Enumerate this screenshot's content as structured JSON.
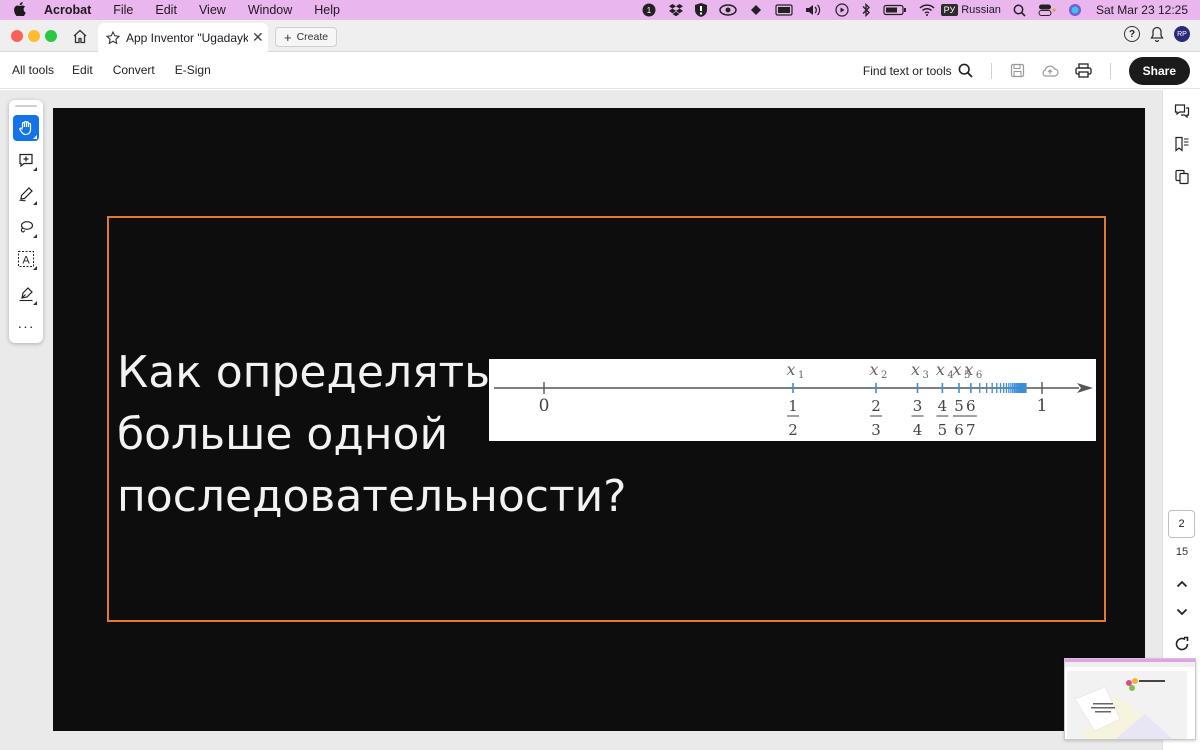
{
  "menubar": {
    "app_name": "Acrobat",
    "menus": [
      "File",
      "Edit",
      "View",
      "Window",
      "Help"
    ],
    "badge_count": "1",
    "input_badge": "РУ",
    "input_language": "Russian",
    "clock": "Sat Mar 23  12:25"
  },
  "tabbar": {
    "tab_title": "App Inventor \"Ugadayk...",
    "create_label": "Create",
    "avatar_initials": "RP"
  },
  "toolbar": {
    "all_tools": "All tools",
    "edit": "Edit",
    "convert": "Convert",
    "esign": "E-Sign",
    "find": "Find text or tools",
    "share": "Share"
  },
  "slide": {
    "heading": "Как определять\nбольше одной\nпоследовательности?",
    "frame_color": "#e07a2e",
    "figure": {
      "left_end_label": "0",
      "right_end_label": "1",
      "points": [
        {
          "var": "x",
          "sub": "1",
          "num": "1",
          "den": "2",
          "value": 0.5
        },
        {
          "var": "x",
          "sub": "2",
          "num": "2",
          "den": "3",
          "value": 0.6667
        },
        {
          "var": "x",
          "sub": "3",
          "num": "3",
          "den": "4",
          "value": 0.75
        },
        {
          "var": "x",
          "sub": "4",
          "num": "4",
          "den": "5",
          "value": 0.8
        },
        {
          "var": "x",
          "sub": "5",
          "num": "5",
          "den": "6",
          "value": 0.8333
        },
        {
          "var": "x",
          "sub": "6",
          "num": "6",
          "den": "7",
          "value": 0.8571
        }
      ],
      "tick_color": "#3b8fd9"
    }
  },
  "pager": {
    "current_page": "2",
    "total_pages": "15"
  },
  "colors": {
    "menubar_bg": "#e9b6ee",
    "accent": "#1473e6",
    "slide_bg": "#0d0d0d"
  }
}
